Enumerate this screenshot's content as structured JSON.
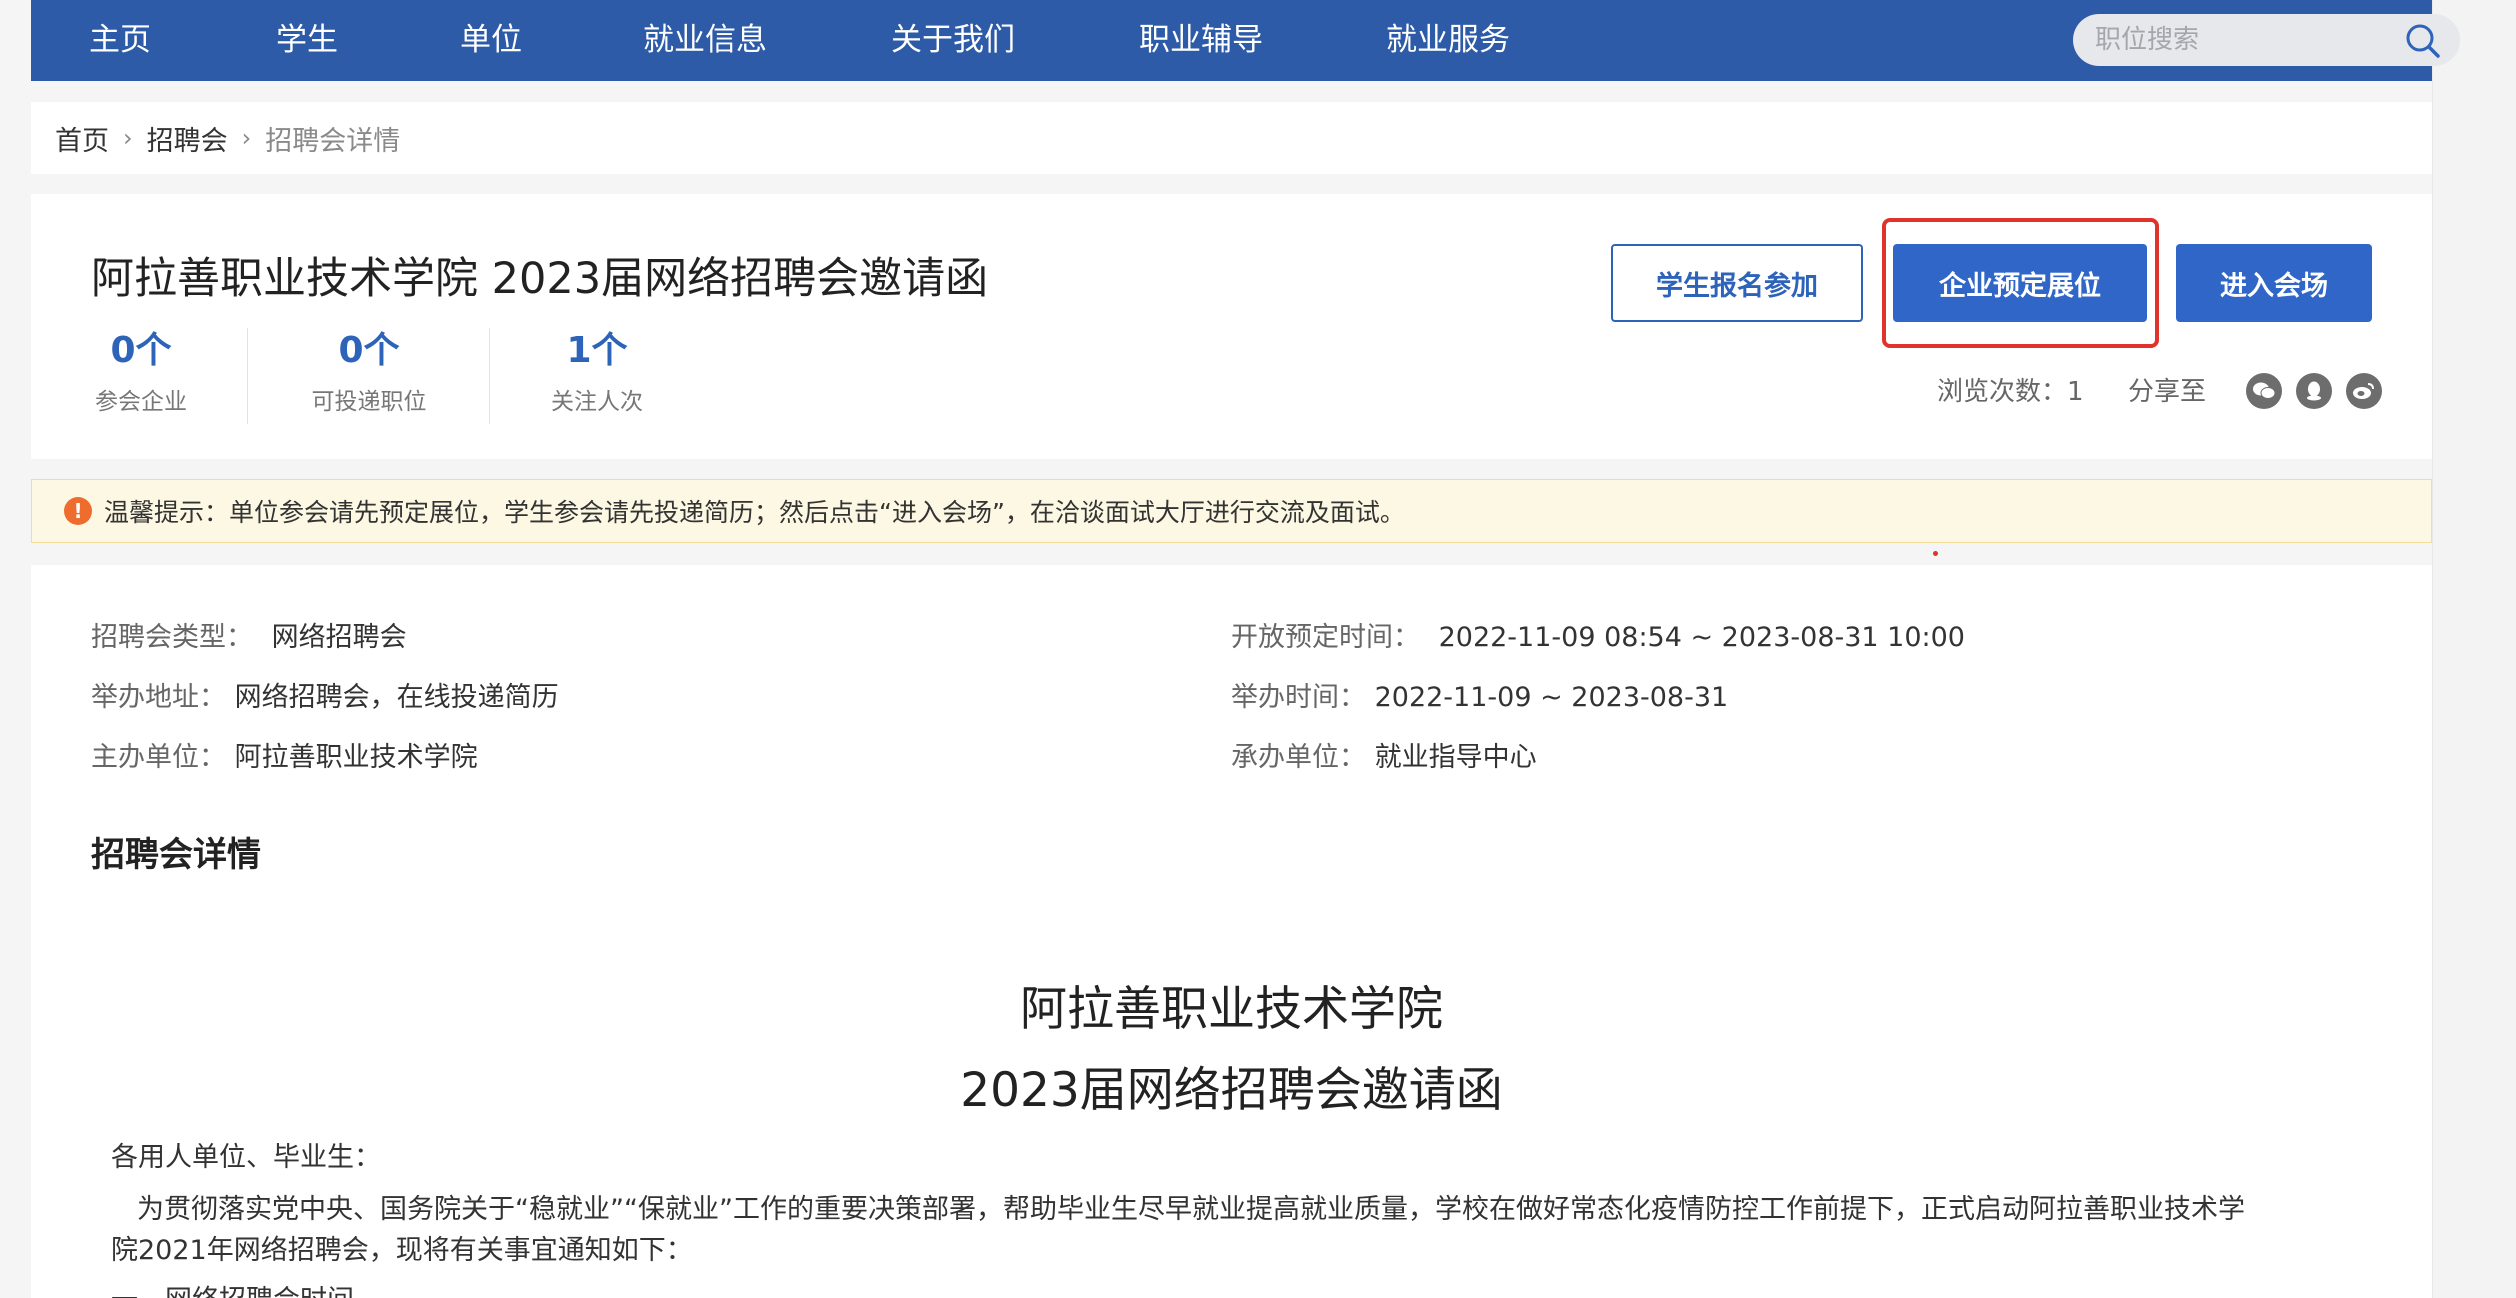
{
  "nav": {
    "items": [
      "主页",
      "学生",
      "单位",
      "就业信息",
      "关于我们",
      "职业辅导",
      "就业服务"
    ],
    "search_placeholder": "职位搜索"
  },
  "breadcrumb": {
    "home": "首页",
    "parent": "招聘会",
    "current": "招聘会详情"
  },
  "fair": {
    "title": "阿拉善职业技术学院 2023届网络招聘会邀请函",
    "stats": [
      {
        "value": "0个",
        "label": "参会企业"
      },
      {
        "value": "0个",
        "label": "可投递职位"
      },
      {
        "value": "1个",
        "label": "关注人次"
      }
    ],
    "buttons": {
      "student": "学生报名参加",
      "company": "企业预定展位",
      "enter": "进入会场"
    },
    "views": "浏览次数：1",
    "share_label": "分享至",
    "share_icons": [
      "wechat-icon",
      "qq-icon",
      "weibo-icon"
    ]
  },
  "notice": {
    "text": "温馨提示：单位参会请先预定展位，学生参会请先投递简历；然后点击“进入会场”，在洽谈面试大厅进行交流及面试。"
  },
  "info": {
    "type_label": "招聘会类型：",
    "type_value": "网络招聘会",
    "booking_label": "开放预定时间：",
    "booking_value": "2022-11-09 08:54 ~ 2023-08-31 10:00",
    "address_label": "举办地址：",
    "address_value": "网络招聘会，在线投递简历",
    "time_label": "举办时间：",
    "time_value": "2022-11-09 ~ 2023-08-31",
    "host_label": "主办单位：",
    "host_value": "阿拉善职业技术学院",
    "organizer_label": "承办单位：",
    "organizer_value": "就业指导中心"
  },
  "details": {
    "section_title": "招聘会详情",
    "doc_title_1": "阿拉善职业技术学院",
    "doc_title_2": "2023届网络招聘会邀请函",
    "greeting": "各用人单位、毕业生：",
    "para_line1": "为贯彻落实党中央、国务院关于“稳就业”“保就业”工作的重要决策部署，帮助毕业生尽早就业提高就业质量，学校在做好常态化疫情防控工作前提下，正式启动阿拉善职业技术学",
    "para_line2": "院2021年网络招聘会，现将有关事宜通知如下：",
    "list_item": "一、网络招聘会时间"
  },
  "colors": {
    "nav_bg": "#2d5ba8",
    "accent": "#2f66c8",
    "highlight": "#e0332b",
    "notice_bg": "#fdf8e3"
  }
}
